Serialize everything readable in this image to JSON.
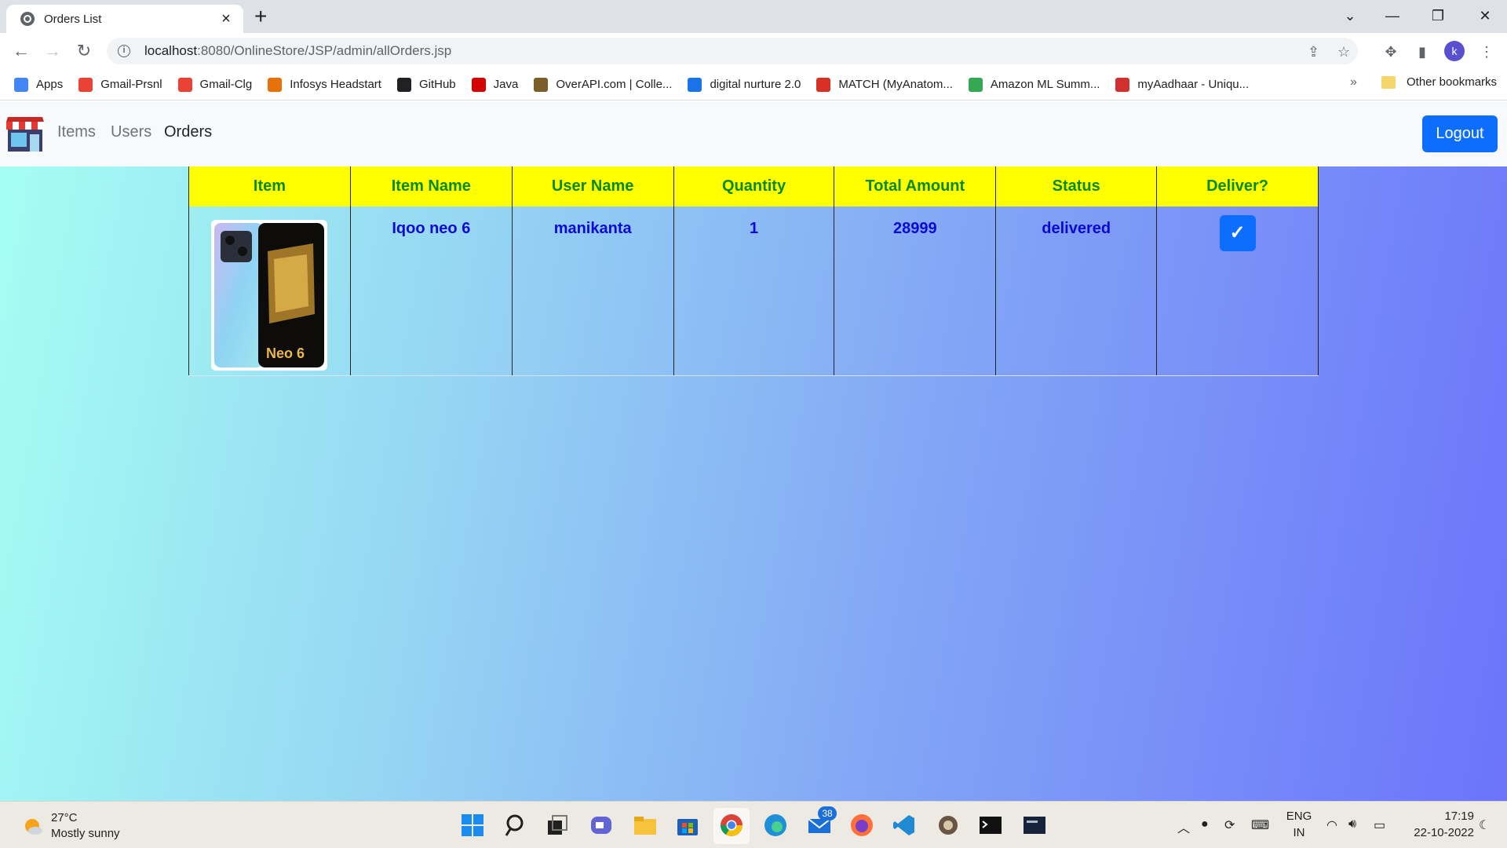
{
  "browser": {
    "tab_title": "Orders List",
    "url_host": "localhost",
    "url_rest": ":8080/OnlineStore/JSP/admin/allOrders.jsp",
    "profile_initial": "k",
    "bookmarks": [
      {
        "label": "Apps",
        "icon": "apps-grid-icon",
        "color": "#4285f4"
      },
      {
        "label": "Gmail-Prsnl",
        "icon": "gmail-icon",
        "color": "#ea4335"
      },
      {
        "label": "Gmail-Clg",
        "icon": "gmail-icon",
        "color": "#ea4335"
      },
      {
        "label": "Infosys Headstart",
        "icon": "infosys-icon",
        "color": "#e8710a"
      },
      {
        "label": "GitHub",
        "icon": "github-icon",
        "color": "#202124"
      },
      {
        "label": "Java",
        "icon": "java-icon",
        "color": "#d50000"
      },
      {
        "label": "OverAPI.com | Colle...",
        "icon": "overapi-icon",
        "color": "#7b5e2a"
      },
      {
        "label": "digital nurture 2.0",
        "icon": "digital-nurture-icon",
        "color": "#1a73e8"
      },
      {
        "label": "MATCH (MyAnatom...",
        "icon": "match-icon",
        "color": "#d93025"
      },
      {
        "label": "Amazon ML Summ...",
        "icon": "amazon-ml-icon",
        "color": "#34a853"
      },
      {
        "label": "myAadhaar - Uniqu...",
        "icon": "aadhaar-icon",
        "color": "#d32f2f"
      }
    ],
    "bookmarks_more": "»",
    "other_bookmarks": "Other bookmarks"
  },
  "navbar": {
    "links": [
      "Items",
      "Users",
      "Orders"
    ],
    "active": "Orders",
    "logout_label": "Logout"
  },
  "orders_table": {
    "headers": [
      "Item",
      "Item Name",
      "User Name",
      "Quantity",
      "Total Amount",
      "Status",
      "Deliver?"
    ],
    "rows": [
      {
        "item_image": "phone-image",
        "item_image_text": "Neo 6",
        "item_name": "Iqoo neo 6",
        "user_name": "manikanta",
        "quantity": "1",
        "total_amount": "28999",
        "status": "delivered",
        "deliver_icon": "✓"
      }
    ],
    "header_bg": "#ffff00",
    "header_text_color": "#0a8a0a",
    "cell_text_color": "#0a0ad6"
  },
  "taskbar": {
    "weather_temp": "27°C",
    "weather_desc": "Mostly sunny",
    "mail_badge": "38",
    "lang_line1": "ENG",
    "lang_line2": "IN",
    "time": "17:19",
    "date": "22-10-2022"
  },
  "colors": {
    "accent": "#0d6efd",
    "gradient_start": "#a5fff3",
    "gradient_end": "#6b74fb"
  }
}
